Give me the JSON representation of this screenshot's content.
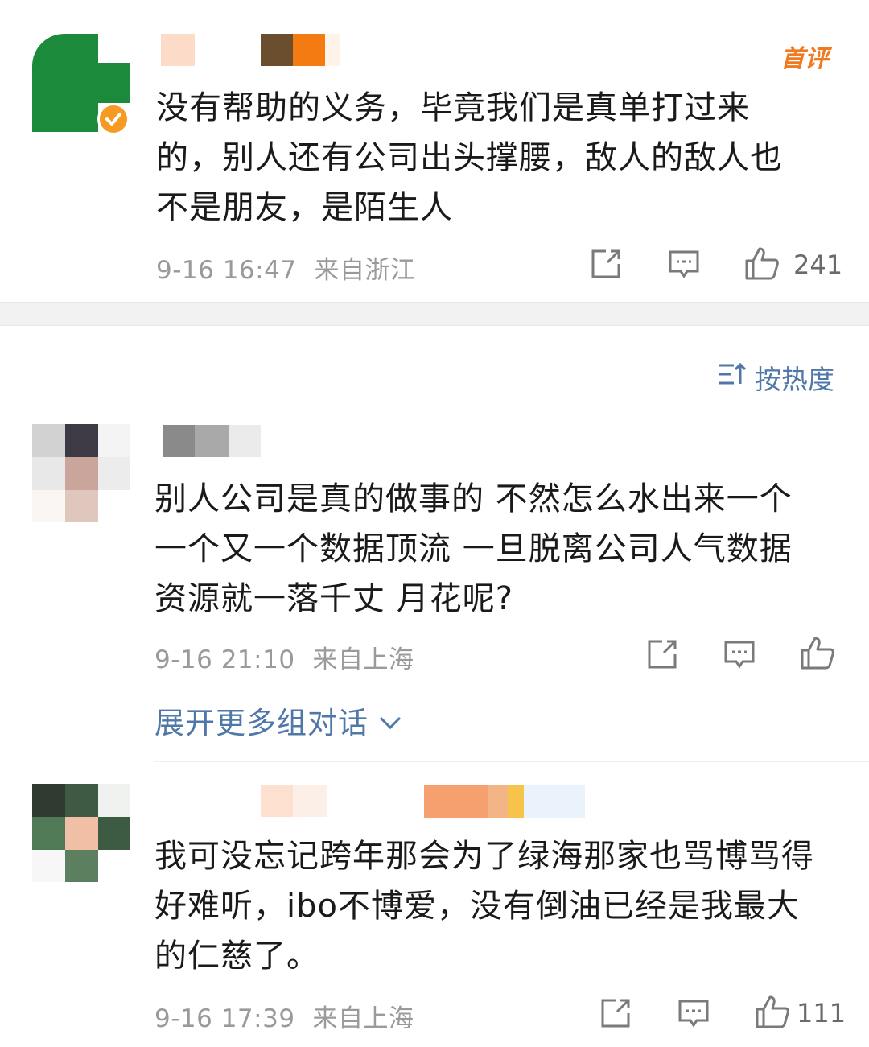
{
  "comments": [
    {
      "badge": "首评",
      "text_lines": [
        "没有帮助的义务，毕竟我们是真单打过来",
        "的，别人还有公司出头撑腰，敌人的敌人也",
        "不是朋友，是陌生人"
      ],
      "time": "9-16 16:47",
      "location": "来自浙江",
      "likes": "241"
    },
    {
      "text_lines": [
        "别人公司是真的做事的 不然怎么水出来一个",
        "一个又一个数据顶流 一旦脱离公司人气数据",
        "资源就一落千丈 月花呢?"
      ],
      "time": "9-16 21:10",
      "location": "来自上海",
      "likes": ""
    },
    {
      "text_lines": [
        "我可没忘记跨年那会为了绿海那家也骂博骂得",
        "好难听，ibo不博爱，没有倒油已经是我最大",
        "的仁慈了。"
      ],
      "time": "9-16 17:39",
      "location": "来自上海",
      "likes": "111"
    }
  ],
  "sort_label": "按热度",
  "expand_label": "展开更多组对话",
  "icons": [
    "share-icon",
    "comment-icon",
    "like-icon",
    "sort-icon",
    "chevron-down-icon",
    "verified-badge-icon"
  ],
  "colors": {
    "link": "#4f77a8",
    "badge": "#f07a22",
    "meta": "#9a9a9a"
  }
}
